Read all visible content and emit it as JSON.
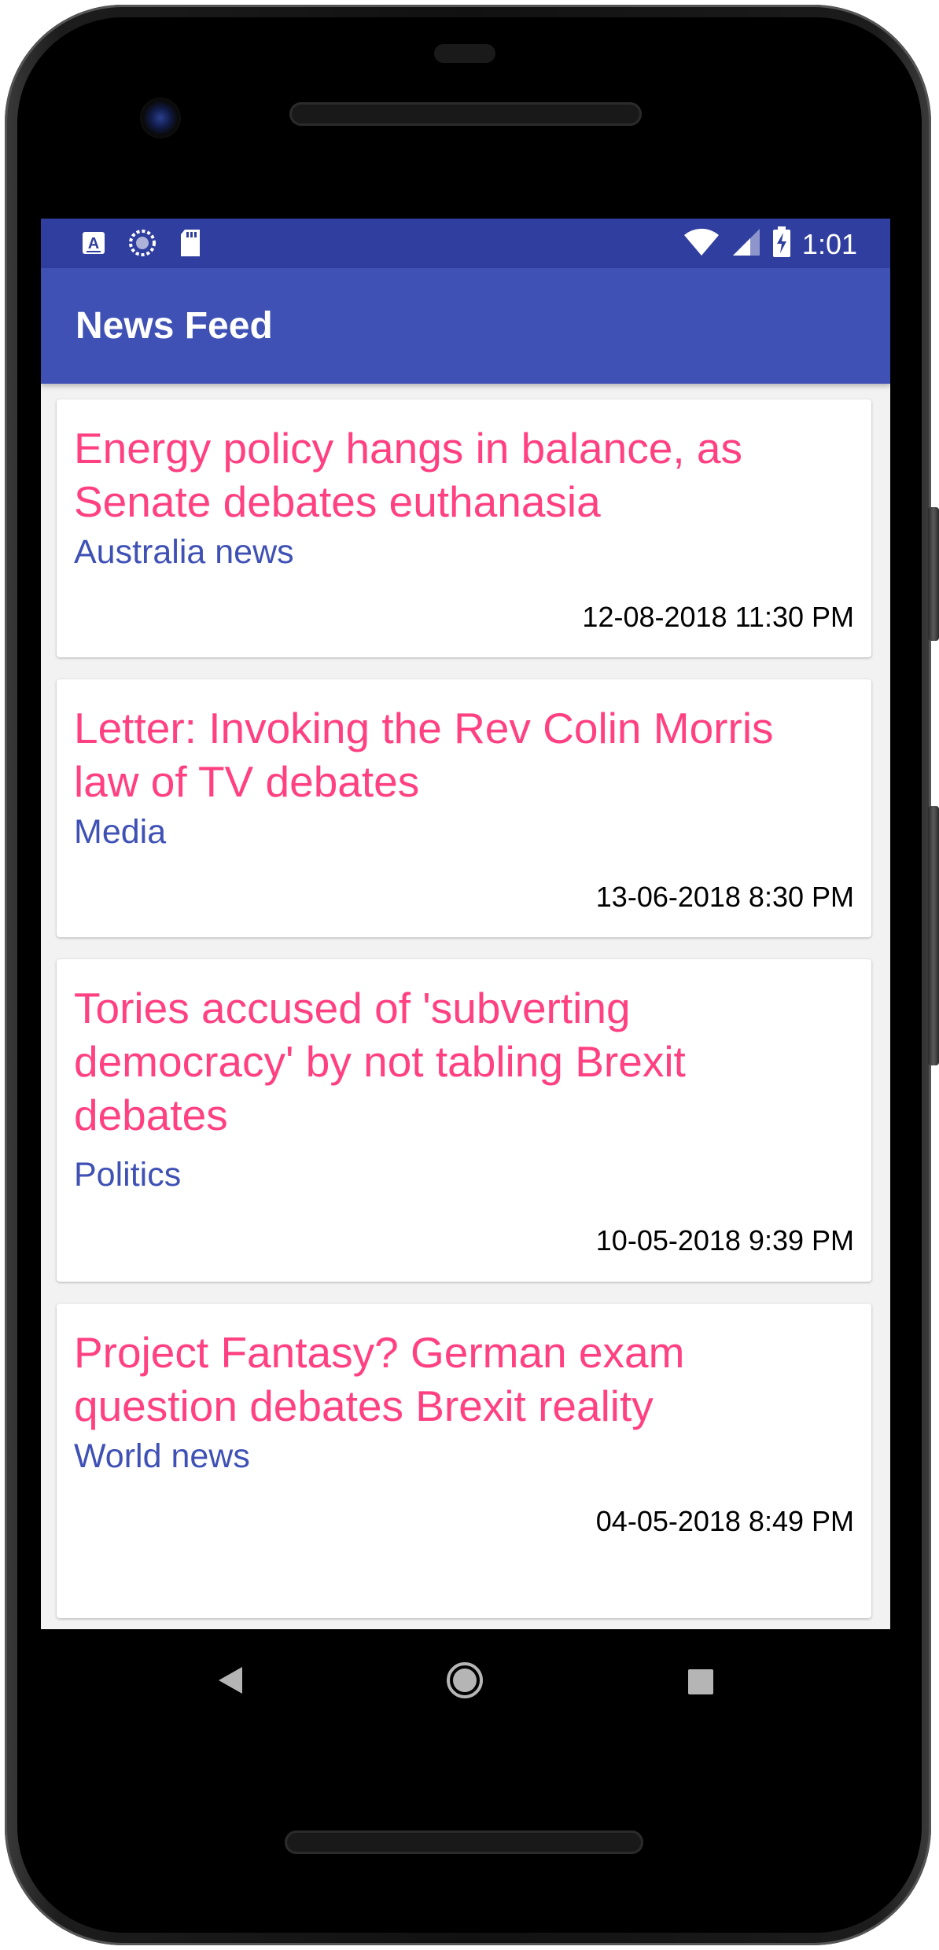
{
  "status_bar": {
    "time": "1:01",
    "icons_left": [
      "a-notification-icon",
      "sync-icon",
      "sd-card-icon"
    ],
    "icons_right": [
      "wifi-icon",
      "signal-icon",
      "battery-charging-icon"
    ]
  },
  "app_bar": {
    "title": "News Feed"
  },
  "colors": {
    "status_bar": "#303f9f",
    "primary": "#3f51b5",
    "accent": "#ff4081",
    "background": "#f2f2f2"
  },
  "articles": [
    {
      "title": "Energy policy hangs in balance, as Senate debates euthanasia",
      "section": "Australia news",
      "date": "12-08-2018 11:30 PM"
    },
    {
      "title": "Letter: Invoking the Rev Colin Morris law of TV debates",
      "section": "Media",
      "date": "13-06-2018 8:30 PM"
    },
    {
      "title": "Tories accused of 'subverting democracy' by not tabling Brexit debates",
      "section": "Politics",
      "date": "10-05-2018 9:39 PM"
    },
    {
      "title": "Project Fantasy? German exam question debates Brexit reality",
      "section": "World news",
      "date": "04-05-2018 8:49 PM"
    }
  ],
  "nav_bar": {
    "buttons": [
      "back-icon",
      "home-icon",
      "recents-icon"
    ]
  }
}
